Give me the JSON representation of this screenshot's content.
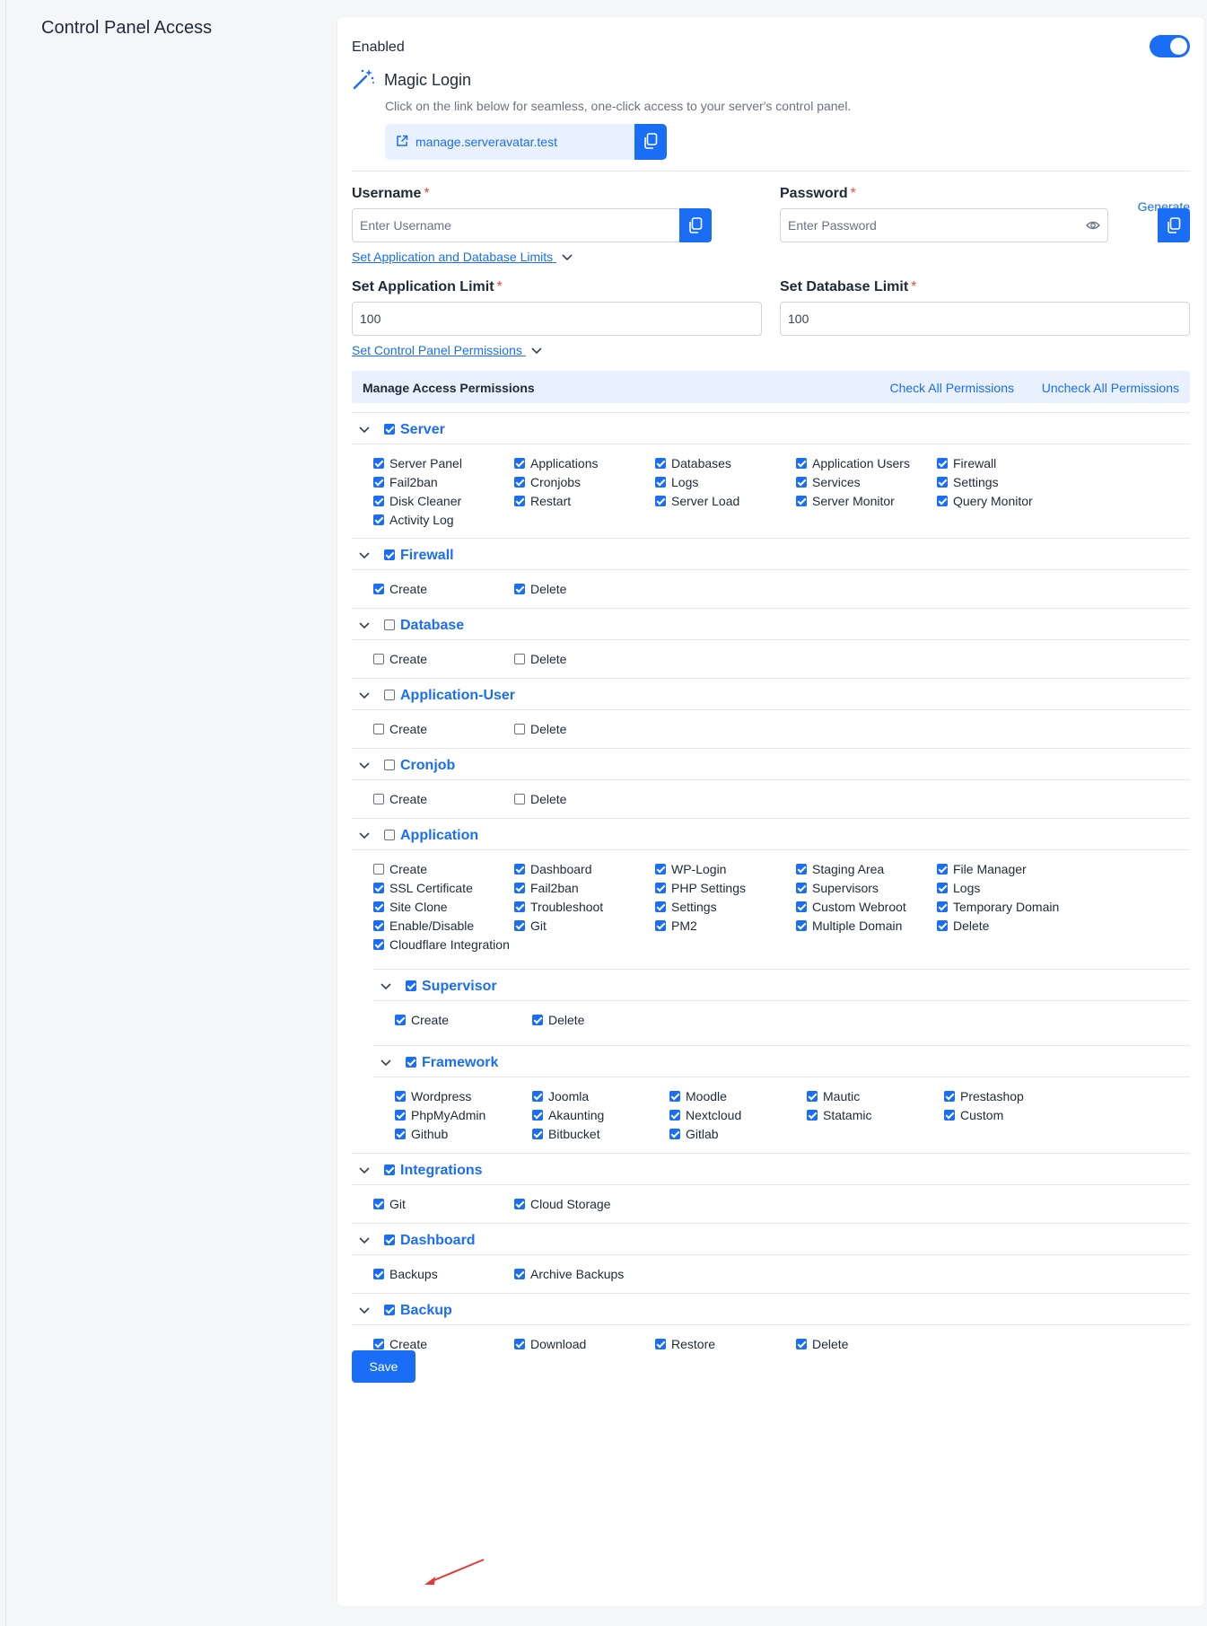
{
  "section_title": "Control Panel Access",
  "enabled": {
    "label": "Enabled",
    "on": true
  },
  "magic_login": {
    "title": "Magic Login",
    "description": "Click on the link below for seamless, one-click access to your server's control panel.",
    "url": "manage.serveravatar.test"
  },
  "username": {
    "label": "Username",
    "placeholder": "Enter Username",
    "required": "*"
  },
  "password": {
    "label": "Password",
    "placeholder": "Enter Password",
    "required": "*",
    "generate": "Generate"
  },
  "limits_toggle": "Set Application and Database Limits",
  "app_limit": {
    "label": "Set Application Limit",
    "value": "100",
    "required": "*"
  },
  "db_limit": {
    "label": "Set Database Limit",
    "value": "100",
    "required": "*"
  },
  "perms_toggle": "Set Control Panel Permissions",
  "manage": {
    "title": "Manage Access Permissions",
    "check_all": "Check All Permissions",
    "uncheck_all": "Uncheck All Permissions"
  },
  "groups": [
    {
      "name": "Server",
      "checked": true,
      "items": [
        [
          "Server Panel",
          true
        ],
        [
          "Applications",
          true
        ],
        [
          "Databases",
          true
        ],
        [
          "Application Users",
          true
        ],
        [
          "Firewall",
          true
        ],
        [
          "Fail2ban",
          true
        ],
        [
          "Cronjobs",
          true
        ],
        [
          "Logs",
          true
        ],
        [
          "Services",
          true
        ],
        [
          "Settings",
          true
        ],
        [
          "Disk Cleaner",
          true
        ],
        [
          "Restart",
          true
        ],
        [
          "Server Load",
          true
        ],
        [
          "Server Monitor",
          true
        ],
        [
          "Query Monitor",
          true
        ],
        [
          "Activity Log",
          true
        ]
      ]
    },
    {
      "name": "Firewall",
      "checked": true,
      "items": [
        [
          "Create",
          true
        ],
        [
          "Delete",
          true
        ]
      ]
    },
    {
      "name": "Database",
      "checked": false,
      "items": [
        [
          "Create",
          false
        ],
        [
          "Delete",
          false
        ]
      ]
    },
    {
      "name": "Application-User",
      "checked": false,
      "items": [
        [
          "Create",
          false
        ],
        [
          "Delete",
          false
        ]
      ]
    },
    {
      "name": "Cronjob",
      "checked": false,
      "items": [
        [
          "Create",
          false
        ],
        [
          "Delete",
          false
        ]
      ]
    },
    {
      "name": "Application",
      "checked": false,
      "items": [
        [
          "Create",
          false
        ],
        [
          "Dashboard",
          true
        ],
        [
          "WP-Login",
          true
        ],
        [
          "Staging Area",
          true
        ],
        [
          "File Manager",
          true
        ],
        [
          "SSL Certificate",
          true
        ],
        [
          "Fail2ban",
          true
        ],
        [
          "PHP Settings",
          true
        ],
        [
          "Supervisors",
          true
        ],
        [
          "Logs",
          true
        ],
        [
          "Site Clone",
          true
        ],
        [
          "Troubleshoot",
          true
        ],
        [
          "Settings",
          true
        ],
        [
          "Custom Webroot",
          true
        ],
        [
          "Temporary Domain",
          true
        ],
        [
          "Enable/Disable",
          true
        ],
        [
          "Git",
          true
        ],
        [
          "PM2",
          true
        ],
        [
          "Multiple Domain",
          true
        ],
        [
          "Delete",
          true
        ],
        [
          "Cloudflare Integration",
          true
        ]
      ]
    },
    {
      "name": "Supervisor",
      "checked": true,
      "items": [
        [
          "Create",
          true
        ],
        [
          "Delete",
          true
        ]
      ]
    },
    {
      "name": "Framework",
      "checked": true,
      "items": [
        [
          "Wordpress",
          true
        ],
        [
          "Joomla",
          true
        ],
        [
          "Moodle",
          true
        ],
        [
          "Mautic",
          true
        ],
        [
          "Prestashop",
          true
        ],
        [
          "PhpMyAdmin",
          true
        ],
        [
          "Akaunting",
          true
        ],
        [
          "Nextcloud",
          true
        ],
        [
          "Statamic",
          true
        ],
        [
          "Custom",
          true
        ],
        [
          "Github",
          true
        ],
        [
          "Bitbucket",
          true
        ],
        [
          "Gitlab",
          true
        ]
      ]
    },
    {
      "name": "Integrations",
      "checked": true,
      "items": [
        [
          "Git",
          true
        ],
        [
          "Cloud Storage",
          true
        ]
      ]
    },
    {
      "name": "Dashboard",
      "checked": true,
      "items": [
        [
          "Backups",
          true
        ],
        [
          "Archive Backups",
          true
        ]
      ]
    },
    {
      "name": "Backup",
      "checked": true,
      "items": [
        [
          "Create",
          true
        ],
        [
          "Download",
          true
        ],
        [
          "Restore",
          true
        ],
        [
          "Delete",
          true
        ]
      ]
    }
  ],
  "save_label": "Save",
  "colors": {
    "accent": "#1a6ef5",
    "required": "#ef4444",
    "annotation_arrow": "#e53935"
  }
}
